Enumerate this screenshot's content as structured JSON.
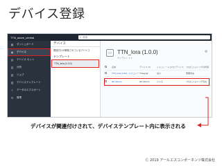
{
  "slide": {
    "title": "デバイス登録",
    "caption": "デバイスが関連付けされて、デバイステンプレート内に表示される",
    "footer": "Ⓒ 2019 アールエスコンポーネンツ株式会社"
  },
  "app": {
    "brand": "TTN_azure_central",
    "search_placeholder": "検索"
  },
  "sidebar": {
    "items": [
      {
        "label": "ダッシュボード",
        "icon": "dashboard-icon",
        "glyph": "▦"
      },
      {
        "label": "デバイス",
        "icon": "device-icon",
        "glyph": "▣",
        "active": true
      },
      {
        "label": "デバイス セット",
        "icon": "device-set-icon",
        "glyph": "▤"
      },
      {
        "label": "分析",
        "icon": "analytics-icon",
        "glyph": "▥"
      },
      {
        "label": "ジョブ",
        "icon": "jobs-icon",
        "glyph": "▧"
      },
      {
        "label": "デバイステンプレート",
        "icon": "template-icon",
        "glyph": "▨"
      },
      {
        "label": "データのエクスポート",
        "icon": "export-icon",
        "glyph": "⇪"
      },
      {
        "label": "管理",
        "icon": "admin-icon",
        "glyph": "⚙"
      }
    ]
  },
  "panel": {
    "header": "デバイス",
    "unassoc": "関連付けが解除されているデバイス",
    "templates_heading": "テンプレート",
    "selected_template": "TTN_lora (1.0.0)"
  },
  "main": {
    "title": "TTN_lora (1.0.0)",
    "subtitle": "テンプレート ▾",
    "columns": [
      "",
      "名前",
      "デバイス ID",
      "シミュレートされたデバイス",
      "プロビジョニングの状態"
    ],
    "rows": [
      {
        "name": "TTN_lora (1.0.0) - シミュレート済み 1",
        "id": "77aegsgf",
        "simulated": "はい",
        "status": "登録済み"
      },
      {
        "name": "lab-fdevice",
        "id": "lab-fdevice",
        "simulated": "いいえ",
        "status": "プロビジョニング済み"
      }
    ]
  },
  "colors": {
    "highlight": "#e02020",
    "sidebar": "#2a323e",
    "link": "#1a66c8"
  }
}
